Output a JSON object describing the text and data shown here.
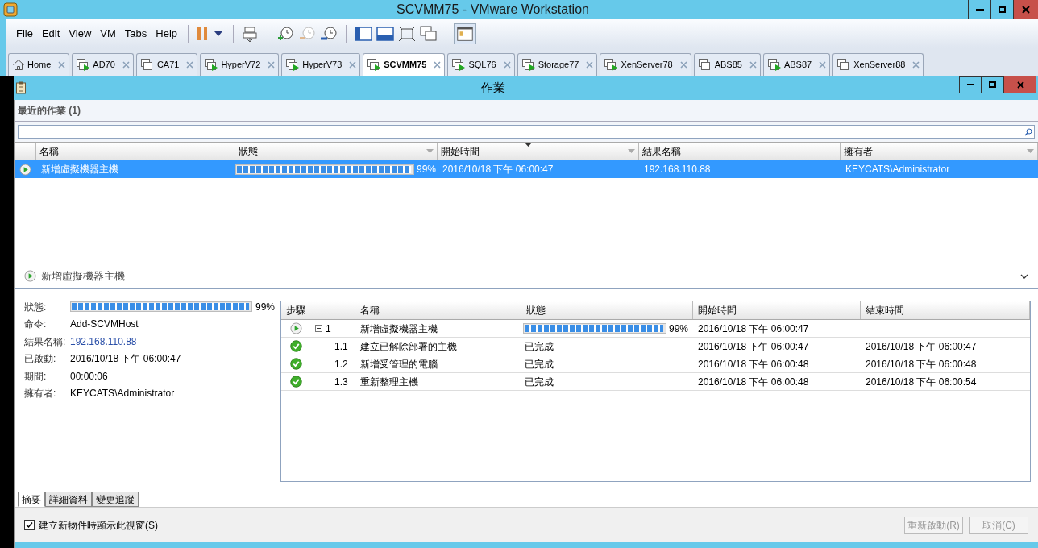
{
  "window": {
    "title": "SCVMM75 - VMware Workstation"
  },
  "menu": [
    "File",
    "Edit",
    "View",
    "VM",
    "Tabs",
    "Help"
  ],
  "tabs": [
    {
      "label": "Home",
      "kind": "home",
      "selected": false
    },
    {
      "label": "AD70",
      "kind": "vm",
      "running": true,
      "selected": false
    },
    {
      "label": "CA71",
      "kind": "vm",
      "running": false,
      "selected": false
    },
    {
      "label": "HyperV72",
      "kind": "vm",
      "running": true,
      "selected": false
    },
    {
      "label": "HyperV73",
      "kind": "vm",
      "running": true,
      "selected": false
    },
    {
      "label": "SCVMM75",
      "kind": "vm",
      "running": true,
      "selected": true
    },
    {
      "label": "SQL76",
      "kind": "vm",
      "running": true,
      "selected": false
    },
    {
      "label": "Storage77",
      "kind": "vm",
      "running": true,
      "selected": false
    },
    {
      "label": "XenServer78",
      "kind": "vm",
      "running": true,
      "selected": false
    },
    {
      "label": "ABS85",
      "kind": "vm",
      "running": false,
      "selected": false
    },
    {
      "label": "ABS87",
      "kind": "vm",
      "running": true,
      "selected": false
    },
    {
      "label": "XenServer88",
      "kind": "vm",
      "running": false,
      "selected": false
    }
  ],
  "dialog": {
    "title": "作業",
    "recent": {
      "title": "最近的作業 (1)",
      "columns": [
        "名稱",
        "狀態",
        "開始時間",
        "結果名稱",
        "擁有者"
      ],
      "rows": [
        {
          "name": "新增虛擬機器主機",
          "level": 0.99,
          "percent": "99%",
          "start": "2016/10/18 下午 06:00:47",
          "result": "192.168.110.88",
          "owner": "KEYCATS\\Administrator",
          "selected": true
        }
      ]
    },
    "detail": {
      "title": "新增虛擬機器主機",
      "fields": [
        {
          "kind": "progress",
          "label": "狀態:",
          "level": 0.99,
          "value": "99%"
        },
        {
          "kind": "text",
          "label": "命令:",
          "value": "Add-SCVMHost"
        },
        {
          "kind": "link",
          "label": "結果名稱:",
          "value": "192.168.110.88"
        },
        {
          "kind": "text",
          "label": "已啟動:",
          "value": "2016/10/18 下午 06:00:47"
        },
        {
          "kind": "text",
          "label": "期間:",
          "value": "00:00:06"
        },
        {
          "kind": "text",
          "label": "擁有者:",
          "value": "KEYCATS\\Administrator"
        }
      ],
      "columns": [
        "步驟",
        "名稱",
        "狀態",
        "開始時間",
        "結束時間"
      ],
      "steps": [
        {
          "kind": "running",
          "step": "1",
          "name": "新增虛擬機器主機",
          "level": 0.99,
          "percent": "99%",
          "start": "2016/10/18 下午 06:00:47",
          "expanded": true,
          "children": [
            {
              "kind": "done",
              "step": "1.1",
              "name": "建立已解除部署的主機",
              "status": "已完成",
              "start": "2016/10/18 下午 06:00:47",
              "end": "2016/10/18 下午 06:00:47"
            },
            {
              "kind": "done",
              "step": "1.2",
              "name": "新增受管理的電腦",
              "status": "已完成",
              "start": "2016/10/18 下午 06:00:48",
              "end": "2016/10/18 下午 06:00:48"
            },
            {
              "kind": "done",
              "step": "1.3",
              "name": "重新整理主機",
              "status": "已完成",
              "start": "2016/10/18 下午 06:00:48",
              "end": "2016/10/18 下午 06:00:54"
            }
          ]
        }
      ]
    },
    "bottom_tabs": [
      {
        "label": "摘要",
        "selected": true
      },
      {
        "label": "詳細資料",
        "selected": false
      },
      {
        "label": "變更追蹤",
        "selected": false
      }
    ],
    "checkbox": {
      "label": "建立新物件時顯示此視窗(S)",
      "checked": true
    },
    "buttons": [
      {
        "label": "重新啟動(R)",
        "disabled": true
      },
      {
        "label": "取消(C)",
        "disabled": true
      }
    ]
  }
}
